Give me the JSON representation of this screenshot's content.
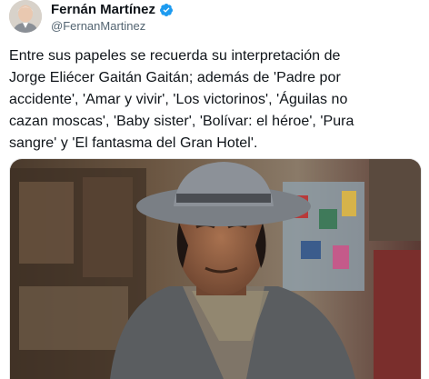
{
  "author": {
    "name": "Fernán Martínez",
    "handle": "@FernanMartinez",
    "verified": true,
    "avatar_icon": "profile-photo-avatar",
    "verified_icon": "verified-badge-icon",
    "verified_color": "#1d9bf0"
  },
  "tweet": {
    "text_lines": [
      "Entre sus papeles se recuerda su interpretación de",
      "Jorge Eliécer Gaitán Gaitán; además de 'Padre por",
      "accidente', 'Amar y vivir', 'Los victorinos', 'Águilas no",
      "cazan moscas', 'Baby sister', 'Bolívar: el héroe', 'Pura",
      "sangre' y 'El fantasma del Gran Hotel'."
    ]
  },
  "media": {
    "type": "photo",
    "icon": "photo-of-actor-in-hat"
  }
}
